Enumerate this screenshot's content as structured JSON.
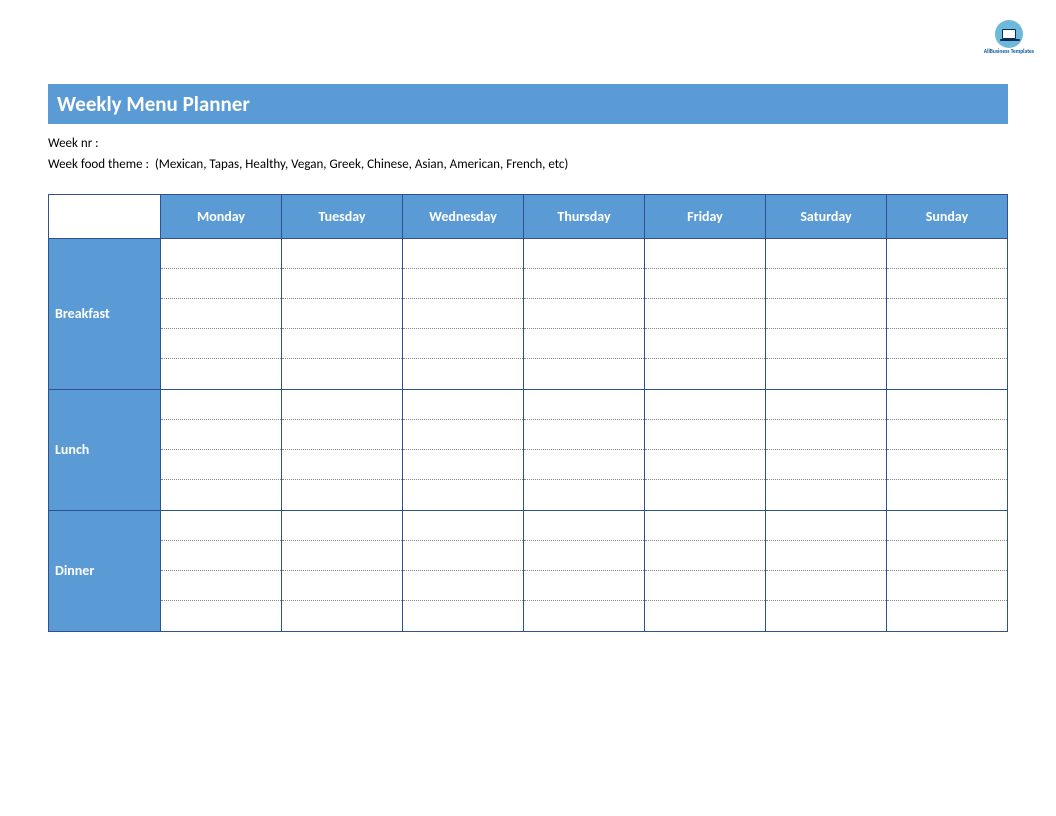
{
  "logo": {
    "text": "AllBusiness\nTemplates"
  },
  "title": "Weekly Menu Planner",
  "meta": {
    "week_nr_label": "Week nr :",
    "week_theme_label": "Week food theme :  ",
    "week_theme_hint": "(Mexican, Tapas, Healthy, Vegan, Greek, Chinese, Asian, American, French, etc)"
  },
  "days": [
    "Monday",
    "Tuesday",
    "Wednesday",
    "Thursday",
    "Friday",
    "Saturday",
    "Sunday"
  ],
  "meals": [
    {
      "name": "Breakfast",
      "lines": 5
    },
    {
      "name": "Lunch",
      "lines": 4
    },
    {
      "name": "Dinner",
      "lines": 4
    }
  ],
  "colors": {
    "accent": "#5b9bd5",
    "border": "#2f528f"
  }
}
